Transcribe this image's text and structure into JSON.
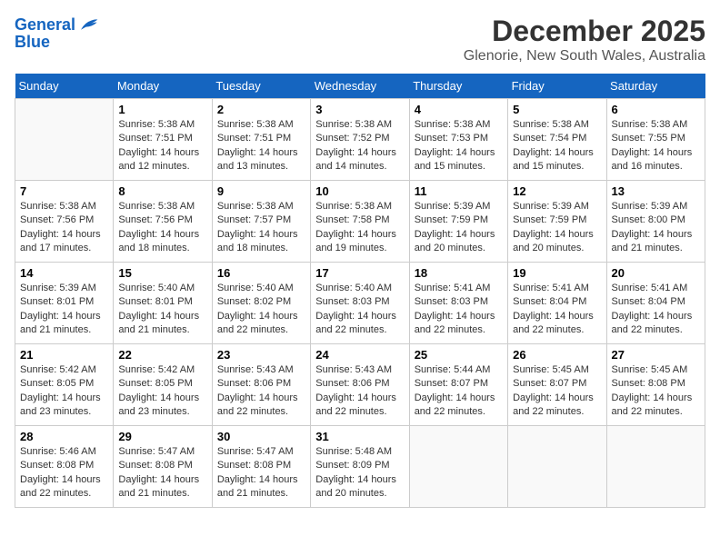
{
  "header": {
    "logo_line1": "General",
    "logo_line2": "Blue",
    "title": "December 2025",
    "subtitle": "Glenorie, New South Wales, Australia"
  },
  "days_of_week": [
    "Sunday",
    "Monday",
    "Tuesday",
    "Wednesday",
    "Thursday",
    "Friday",
    "Saturday"
  ],
  "weeks": [
    [
      {
        "day": "",
        "info": ""
      },
      {
        "day": "1",
        "info": "Sunrise: 5:38 AM\nSunset: 7:51 PM\nDaylight: 14 hours\nand 12 minutes."
      },
      {
        "day": "2",
        "info": "Sunrise: 5:38 AM\nSunset: 7:51 PM\nDaylight: 14 hours\nand 13 minutes."
      },
      {
        "day": "3",
        "info": "Sunrise: 5:38 AM\nSunset: 7:52 PM\nDaylight: 14 hours\nand 14 minutes."
      },
      {
        "day": "4",
        "info": "Sunrise: 5:38 AM\nSunset: 7:53 PM\nDaylight: 14 hours\nand 15 minutes."
      },
      {
        "day": "5",
        "info": "Sunrise: 5:38 AM\nSunset: 7:54 PM\nDaylight: 14 hours\nand 15 minutes."
      },
      {
        "day": "6",
        "info": "Sunrise: 5:38 AM\nSunset: 7:55 PM\nDaylight: 14 hours\nand 16 minutes."
      }
    ],
    [
      {
        "day": "7",
        "info": "Sunrise: 5:38 AM\nSunset: 7:56 PM\nDaylight: 14 hours\nand 17 minutes."
      },
      {
        "day": "8",
        "info": "Sunrise: 5:38 AM\nSunset: 7:56 PM\nDaylight: 14 hours\nand 18 minutes."
      },
      {
        "day": "9",
        "info": "Sunrise: 5:38 AM\nSunset: 7:57 PM\nDaylight: 14 hours\nand 18 minutes."
      },
      {
        "day": "10",
        "info": "Sunrise: 5:38 AM\nSunset: 7:58 PM\nDaylight: 14 hours\nand 19 minutes."
      },
      {
        "day": "11",
        "info": "Sunrise: 5:39 AM\nSunset: 7:59 PM\nDaylight: 14 hours\nand 20 minutes."
      },
      {
        "day": "12",
        "info": "Sunrise: 5:39 AM\nSunset: 7:59 PM\nDaylight: 14 hours\nand 20 minutes."
      },
      {
        "day": "13",
        "info": "Sunrise: 5:39 AM\nSunset: 8:00 PM\nDaylight: 14 hours\nand 21 minutes."
      }
    ],
    [
      {
        "day": "14",
        "info": "Sunrise: 5:39 AM\nSunset: 8:01 PM\nDaylight: 14 hours\nand 21 minutes."
      },
      {
        "day": "15",
        "info": "Sunrise: 5:40 AM\nSunset: 8:01 PM\nDaylight: 14 hours\nand 21 minutes."
      },
      {
        "day": "16",
        "info": "Sunrise: 5:40 AM\nSunset: 8:02 PM\nDaylight: 14 hours\nand 22 minutes."
      },
      {
        "day": "17",
        "info": "Sunrise: 5:40 AM\nSunset: 8:03 PM\nDaylight: 14 hours\nand 22 minutes."
      },
      {
        "day": "18",
        "info": "Sunrise: 5:41 AM\nSunset: 8:03 PM\nDaylight: 14 hours\nand 22 minutes."
      },
      {
        "day": "19",
        "info": "Sunrise: 5:41 AM\nSunset: 8:04 PM\nDaylight: 14 hours\nand 22 minutes."
      },
      {
        "day": "20",
        "info": "Sunrise: 5:41 AM\nSunset: 8:04 PM\nDaylight: 14 hours\nand 22 minutes."
      }
    ],
    [
      {
        "day": "21",
        "info": "Sunrise: 5:42 AM\nSunset: 8:05 PM\nDaylight: 14 hours\nand 23 minutes."
      },
      {
        "day": "22",
        "info": "Sunrise: 5:42 AM\nSunset: 8:05 PM\nDaylight: 14 hours\nand 23 minutes."
      },
      {
        "day": "23",
        "info": "Sunrise: 5:43 AM\nSunset: 8:06 PM\nDaylight: 14 hours\nand 22 minutes."
      },
      {
        "day": "24",
        "info": "Sunrise: 5:43 AM\nSunset: 8:06 PM\nDaylight: 14 hours\nand 22 minutes."
      },
      {
        "day": "25",
        "info": "Sunrise: 5:44 AM\nSunset: 8:07 PM\nDaylight: 14 hours\nand 22 minutes."
      },
      {
        "day": "26",
        "info": "Sunrise: 5:45 AM\nSunset: 8:07 PM\nDaylight: 14 hours\nand 22 minutes."
      },
      {
        "day": "27",
        "info": "Sunrise: 5:45 AM\nSunset: 8:08 PM\nDaylight: 14 hours\nand 22 minutes."
      }
    ],
    [
      {
        "day": "28",
        "info": "Sunrise: 5:46 AM\nSunset: 8:08 PM\nDaylight: 14 hours\nand 22 minutes."
      },
      {
        "day": "29",
        "info": "Sunrise: 5:47 AM\nSunset: 8:08 PM\nDaylight: 14 hours\nand 21 minutes."
      },
      {
        "day": "30",
        "info": "Sunrise: 5:47 AM\nSunset: 8:08 PM\nDaylight: 14 hours\nand 21 minutes."
      },
      {
        "day": "31",
        "info": "Sunrise: 5:48 AM\nSunset: 8:09 PM\nDaylight: 14 hours\nand 20 minutes."
      },
      {
        "day": "",
        "info": ""
      },
      {
        "day": "",
        "info": ""
      },
      {
        "day": "",
        "info": ""
      }
    ]
  ]
}
